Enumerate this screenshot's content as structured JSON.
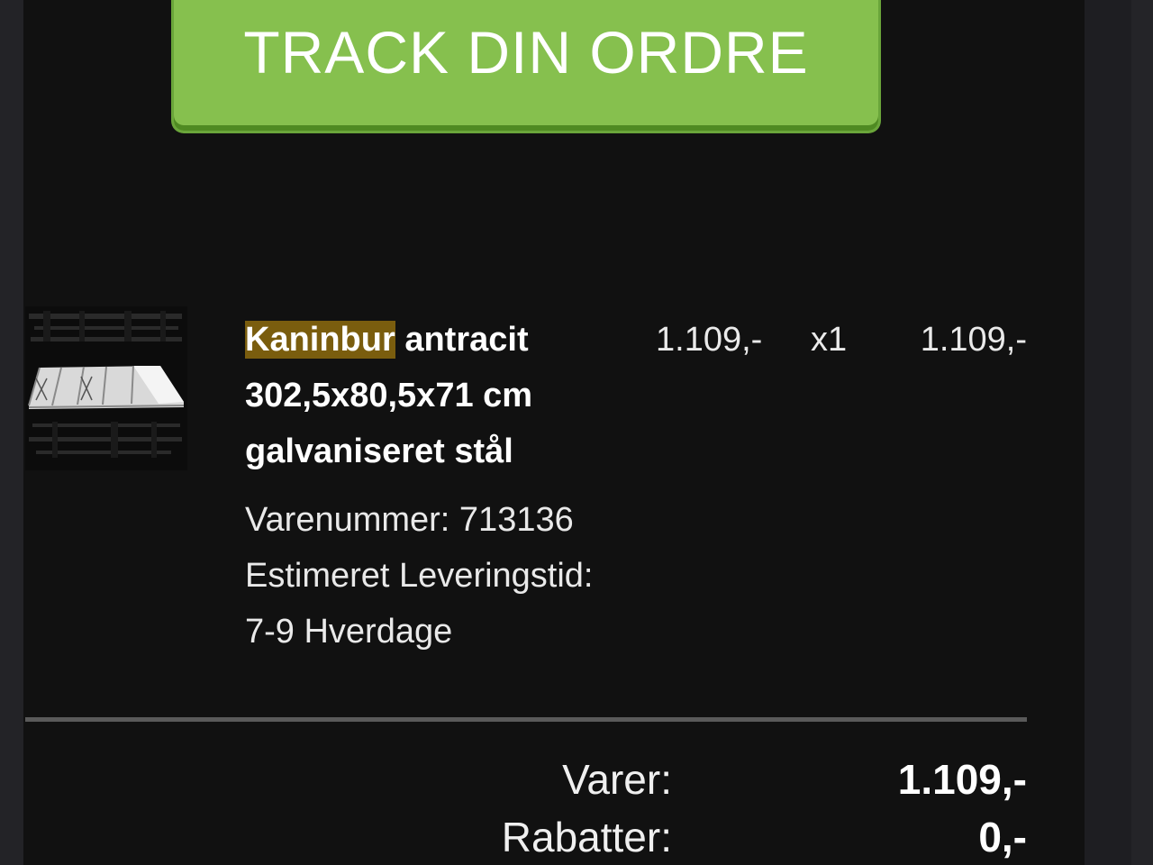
{
  "track_button": {
    "label": "TRACK DIN ORDRE"
  },
  "product": {
    "image_icon": "rabbit-cage-image",
    "title_highlight": "Kaninbur",
    "title_rest_line1": " antracit",
    "title_line2": "302,5x80,5x71 cm",
    "title_line3": "galvaniseret stål",
    "sku_line": "Varenummer: 713136",
    "delivery_label": "Estimeret Leveringstid:",
    "delivery_value": "7-9 Hverdage",
    "unit_price": "1.109,-",
    "quantity": "x1",
    "line_total": "1.109,-"
  },
  "summary": {
    "items_label": "Varer:",
    "items_value": "1.109,-",
    "discounts_label": "Rabatter:",
    "discounts_value": "0,-"
  },
  "colors": {
    "button": "#86c04e",
    "background": "#111111",
    "highlight": "#7a5d0e"
  }
}
